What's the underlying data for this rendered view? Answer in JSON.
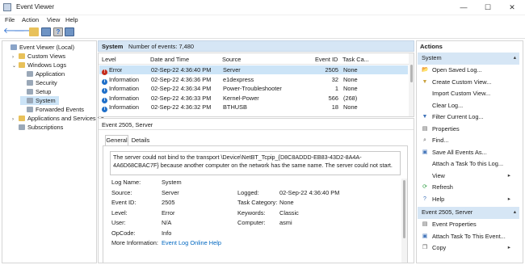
{
  "window": {
    "title": "Event Viewer",
    "minimize": "—",
    "maximize": "☐",
    "close": "✕"
  },
  "menu": [
    "File",
    "Action",
    "View",
    "Help"
  ],
  "tree": {
    "items": [
      {
        "label": "Event Viewer (Local)",
        "indent": 0,
        "caret": "",
        "icon": "event-viewer-icon",
        "color": "#8aa4c8"
      },
      {
        "label": "Custom Views",
        "indent": 1,
        "caret": "›",
        "icon": "folder-icon",
        "color": "#e8c15a"
      },
      {
        "label": "Windows Logs",
        "indent": 1,
        "caret": "⌄",
        "icon": "folder-icon",
        "color": "#e8c15a"
      },
      {
        "label": "Application",
        "indent": 2,
        "caret": "",
        "icon": "log-icon",
        "color": "#9aa8b8"
      },
      {
        "label": "Security",
        "indent": 2,
        "caret": "",
        "icon": "log-icon",
        "color": "#9aa8b8"
      },
      {
        "label": "Setup",
        "indent": 2,
        "caret": "",
        "icon": "log-icon",
        "color": "#9aa8b8"
      },
      {
        "label": "System",
        "indent": 2,
        "caret": "",
        "icon": "log-icon",
        "color": "#9aa8b8",
        "selected": true
      },
      {
        "label": "Forwarded Events",
        "indent": 2,
        "caret": "",
        "icon": "log-icon",
        "color": "#9aa8b8"
      },
      {
        "label": "Applications and Services Lo",
        "indent": 1,
        "caret": "›",
        "icon": "folder-icon",
        "color": "#e8c15a"
      },
      {
        "label": "Subscriptions",
        "indent": 1,
        "caret": "",
        "icon": "subscriptions-icon",
        "color": "#9aa8b8"
      }
    ]
  },
  "log_header": {
    "name": "System",
    "count_label": "Number of events: 7,480"
  },
  "columns": [
    "Level",
    "Date and Time",
    "Source",
    "Event ID",
    "Task Ca..."
  ],
  "events": [
    {
      "level": "Error",
      "level_icon": "error-icon",
      "date": "02-Sep-22 4:36:40 PM",
      "source": "Server",
      "id": "2505",
      "task": "None",
      "selected": true
    },
    {
      "level": "Information",
      "level_icon": "info-icon",
      "date": "02-Sep-22 4:36:36 PM",
      "source": "e1dexpress",
      "id": "32",
      "task": "None"
    },
    {
      "level": "Information",
      "level_icon": "info-icon",
      "date": "02-Sep-22 4:36:34 PM",
      "source": "Power-Troubleshooter",
      "id": "1",
      "task": "None"
    },
    {
      "level": "Information",
      "level_icon": "info-icon",
      "date": "02-Sep-22 4:36:33 PM",
      "source": "Kernel-Power",
      "id": "566",
      "task": "(268)"
    },
    {
      "level": "Information",
      "level_icon": "info-icon",
      "date": "02-Sep-22 4:36:32 PM",
      "source": "BTHUSB",
      "id": "18",
      "task": "None"
    }
  ],
  "detail": {
    "title": "Event 2505, Server",
    "tabs": [
      "General",
      "Details"
    ],
    "message": "The server could not bind to the transport \\Device\\NetBT_Tcpip_{D8C8ADDD-EB83-43D2-8A4A-4A6D68CBAC7F} because another computer on the network has the same name.  The server could not start.",
    "fields_left": [
      {
        "label": "Log Name:",
        "value": "System"
      },
      {
        "label": "Source:",
        "value": "Server"
      },
      {
        "label": "Event ID:",
        "value": "2505"
      },
      {
        "label": "Level:",
        "value": "Error"
      },
      {
        "label": "User:",
        "value": "N/A"
      },
      {
        "label": "OpCode:",
        "value": "Info"
      },
      {
        "label": "More Information:",
        "value": "Event Log Online Help"
      }
    ],
    "fields_right": [
      {
        "label": "Logged:",
        "value": "02-Sep-22 4:36:40 PM"
      },
      {
        "label": "Task Category:",
        "value": "None"
      },
      {
        "label": "Keywords:",
        "value": "Classic"
      },
      {
        "label": "Computer:",
        "value": "asmi"
      }
    ]
  },
  "actions": {
    "title": "Actions",
    "section1": {
      "label": "System",
      "toggle": "▴"
    },
    "items1": [
      {
        "label": "Open Saved Log...",
        "icon": "open-log-icon",
        "glyph": "📂",
        "color": "#c9a13d"
      },
      {
        "label": "Create Custom View...",
        "icon": "create-view-icon",
        "glyph": "▼",
        "color": "#c9a13d"
      },
      {
        "label": "Import Custom View...",
        "icon": "",
        "glyph": "",
        "color": ""
      },
      {
        "label": "Clear Log...",
        "icon": "",
        "glyph": "",
        "color": ""
      },
      {
        "label": "Filter Current Log...",
        "icon": "filter-icon",
        "glyph": "▼",
        "color": "#3f72b8"
      },
      {
        "label": "Properties",
        "icon": "properties-icon",
        "glyph": "▤",
        "color": "#555555"
      },
      {
        "label": "Find...",
        "icon": "find-icon",
        "glyph": "⌕",
        "color": "#555555"
      },
      {
        "label": "Save All Events As...",
        "icon": "save-icon",
        "glyph": "▣",
        "color": "#3f72b8"
      },
      {
        "label": "Attach a Task To this Log...",
        "icon": "",
        "glyph": "",
        "color": ""
      },
      {
        "label": "View",
        "icon": "",
        "glyph": "",
        "color": "",
        "arrow": "▸"
      },
      {
        "label": "Refresh",
        "icon": "refresh-icon",
        "glyph": "⟳",
        "color": "#2f9e44"
      },
      {
        "label": "Help",
        "icon": "help-icon",
        "glyph": "?",
        "color": "#3f72b8",
        "arrow": "▸"
      }
    ],
    "section2": {
      "label": "Event 2505, Server",
      "toggle": "▴"
    },
    "items2": [
      {
        "label": "Event Properties",
        "icon": "event-properties-icon",
        "glyph": "▤",
        "color": "#555555"
      },
      {
        "label": "Attach Task To This Event...",
        "icon": "attach-task-icon",
        "glyph": "▣",
        "color": "#3f72b8"
      },
      {
        "label": "Copy",
        "icon": "copy-icon",
        "glyph": "❐",
        "color": "#555555",
        "arrow": "▸"
      }
    ]
  }
}
